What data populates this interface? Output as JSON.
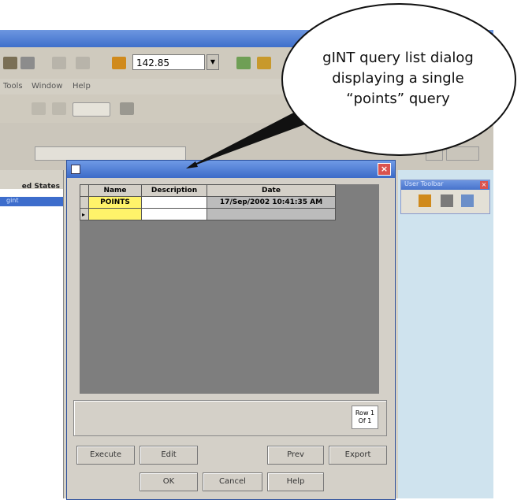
{
  "callout": {
    "line1": "gINT query list dialog",
    "line2": "displaying a single",
    "line3": "“points” query"
  },
  "app": {
    "title": "",
    "zoom": "142.85",
    "menu": [
      "Tools",
      "Window",
      "Help"
    ],
    "left_panel": {
      "header": "ed States",
      "selected": "gint"
    },
    "user_toolbar_title": "User Toolbar"
  },
  "dialog": {
    "title": "",
    "close_symbol": "×",
    "grid": {
      "columns": [
        "Name",
        "Description",
        "Date"
      ],
      "rows": [
        {
          "name": "POINTS",
          "description": "",
          "date": "17/Sep/2002 10:41:35 AM"
        }
      ],
      "new_row_marker": "▸"
    },
    "row_counter": {
      "line1": "Row 1",
      "line2": "Of 1"
    },
    "buttons": {
      "execute": "Execute",
      "edit": "Edit",
      "prev": "Prev",
      "export": "Export",
      "ok": "OK",
      "cancel": "Cancel",
      "help": "Help"
    }
  },
  "colors": {
    "name_cell": "#fff36a",
    "titlebar": "#3c6bc8",
    "grid_bg": "#7e7e7e"
  }
}
